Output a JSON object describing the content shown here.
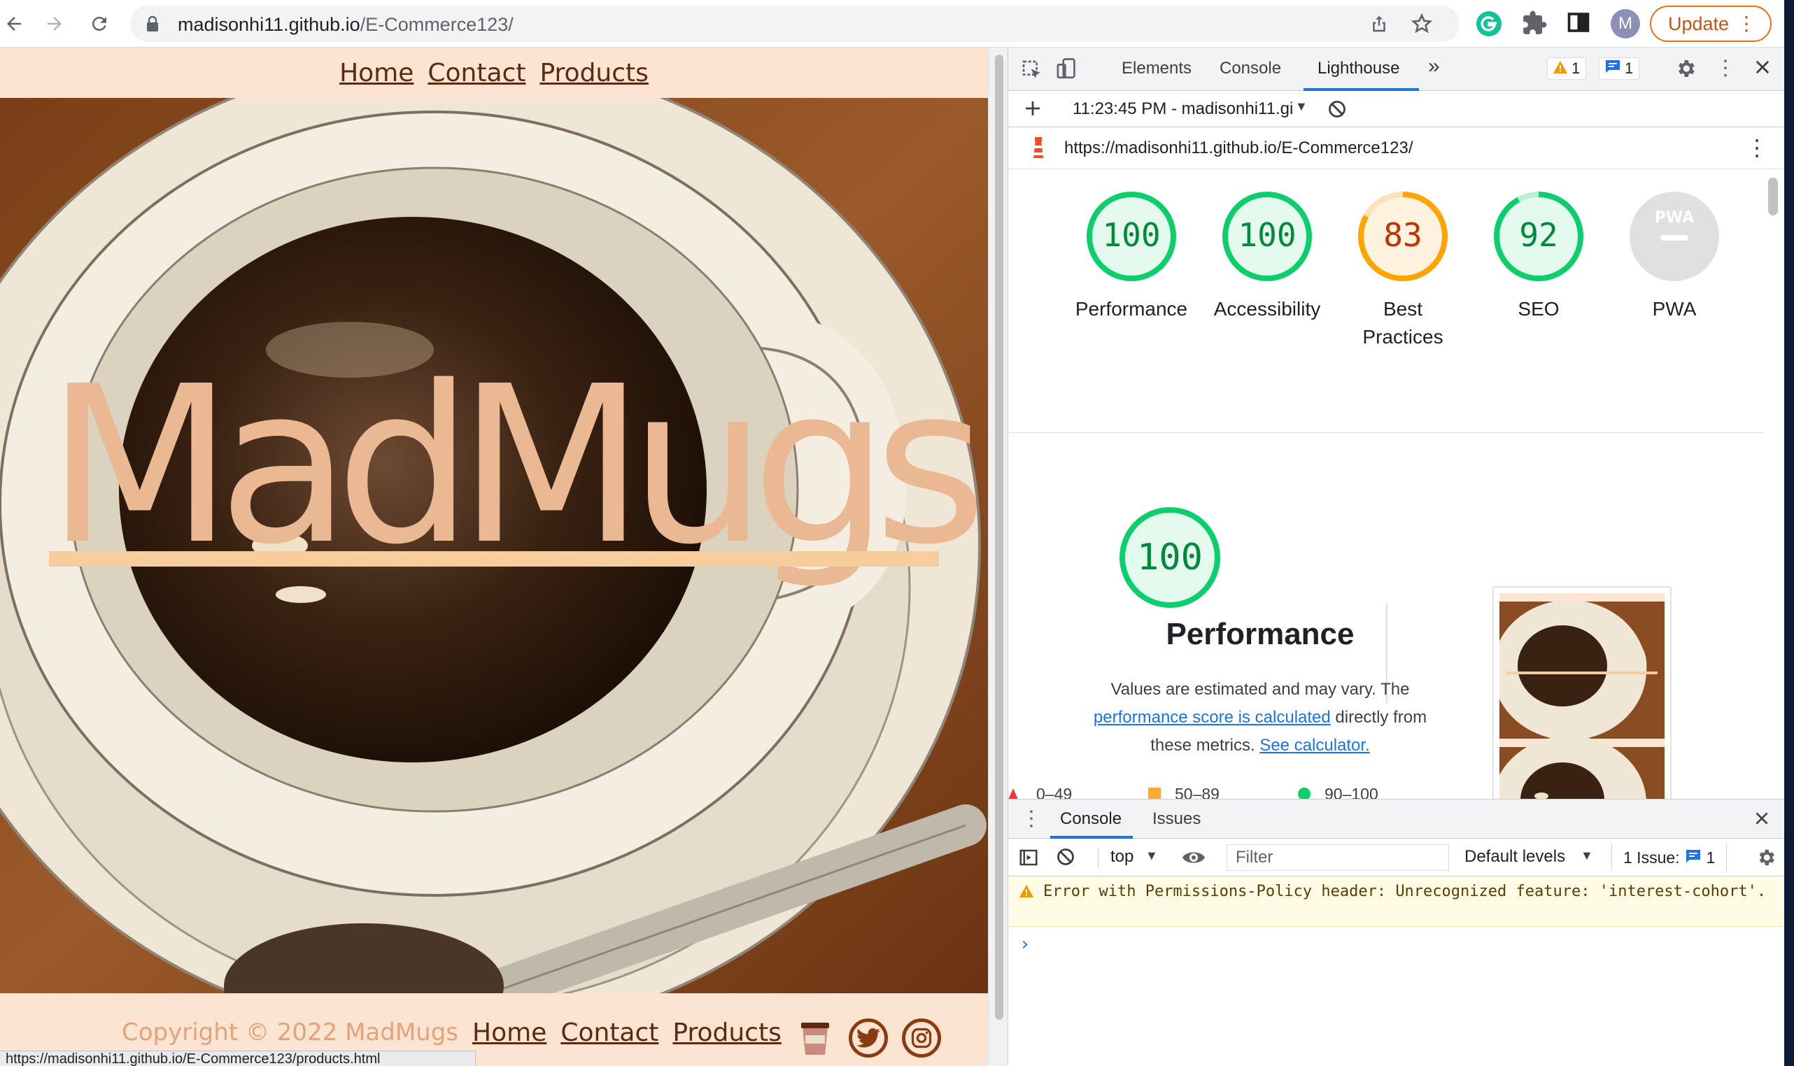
{
  "browser": {
    "url_domain": "madisonhi11.github.io",
    "url_path": "/E-Commerce123/",
    "avatar_letter": "M",
    "update_label": "Update",
    "status_url": "https://madisonhi11.github.io/E-Commerce123/products.html"
  },
  "site": {
    "nav": [
      "Home",
      "Contact",
      "Products"
    ],
    "brand": "MadMugs",
    "copyright": "Copyright © 2022 MadMugs",
    "footer_nav": [
      "Home",
      "Contact",
      "Products"
    ],
    "colors": {
      "brand": "#eab892",
      "nav_link": "#5b2a10",
      "background": "#fbe5d2"
    }
  },
  "devtools": {
    "tabs": [
      "Elements",
      "Console",
      "Lighthouse"
    ],
    "active_tab": "Lighthouse",
    "more_tabs": "»",
    "warning_count": "1",
    "message_count": "1",
    "report_time": "11:23:45 PM - madisonhi11.gi",
    "report_url": "https://madisonhi11.github.io/E-Commerce123/",
    "scores": [
      {
        "label": "Performance",
        "value": "100",
        "status": "pass"
      },
      {
        "label": "Accessibility",
        "value": "100",
        "status": "pass"
      },
      {
        "label": "Best Practices",
        "value": "83",
        "status": "average"
      },
      {
        "label": "SEO",
        "value": "92",
        "status": "pass"
      },
      {
        "label": "PWA",
        "value": "",
        "status": "na",
        "badge": "PWA"
      }
    ],
    "performance": {
      "score": "100",
      "title": "Performance",
      "desc_1": "Values are estimated and may vary. The",
      "desc_link_1": "performance score is calculated",
      "desc_2": "directly from",
      "desc_3": "these metrics.",
      "desc_link_2": "See calculator."
    },
    "legend": [
      {
        "range": "0–49",
        "color": "#ff3333"
      },
      {
        "range": "50–89",
        "color": "#ffaa33"
      },
      {
        "range": "90–100",
        "color": "#0cce6b"
      }
    ],
    "colors": {
      "pass": "#0cce6b",
      "average": "#ffa400",
      "fail": "#ff4e42"
    }
  },
  "console": {
    "tabs": [
      "Console",
      "Issues"
    ],
    "context": "top",
    "filter_placeholder": "Filter",
    "levels": "Default levels",
    "issues_label": "1 Issue:",
    "issues_count": "1",
    "message": "Error with Permissions-Policy header: Unrecognized feature: 'interest-cohort'.",
    "prompt": "›"
  }
}
